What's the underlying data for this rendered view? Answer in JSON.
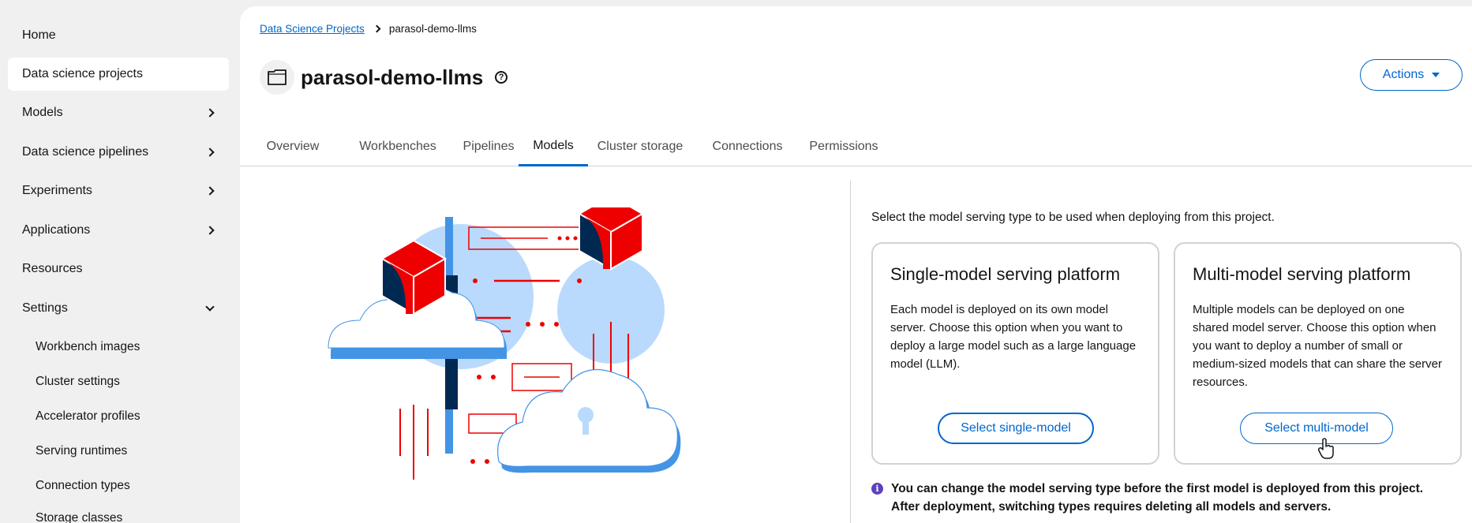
{
  "sidebar": {
    "items": [
      {
        "label": "Home"
      },
      {
        "label": "Data science projects"
      },
      {
        "label": "Models"
      },
      {
        "label": "Data science pipelines"
      },
      {
        "label": "Experiments"
      },
      {
        "label": "Applications"
      },
      {
        "label": "Resources"
      },
      {
        "label": "Settings"
      }
    ],
    "settings_sub": [
      {
        "label": "Workbench images"
      },
      {
        "label": "Cluster settings"
      },
      {
        "label": "Accelerator profiles"
      },
      {
        "label": "Serving runtimes"
      },
      {
        "label": "Connection types"
      },
      {
        "label": "Storage classes"
      }
    ]
  },
  "breadcrumb": {
    "root": "Data Science Projects",
    "current": "parasol-demo-llms"
  },
  "page": {
    "title": "parasol-demo-llms",
    "actions_label": "Actions"
  },
  "tabs": [
    {
      "label": "Overview"
    },
    {
      "label": "Workbenches"
    },
    {
      "label": "Pipelines"
    },
    {
      "label": "Models"
    },
    {
      "label": "Cluster storage"
    },
    {
      "label": "Connections"
    },
    {
      "label": "Permissions"
    }
  ],
  "serving": {
    "intro": "Select the model serving type to be used when deploying from this project.",
    "single": {
      "title": "Single-model serving platform",
      "description": "Each model is deployed on its own model server. Choose this option when you want to deploy a large model such as a large language model (LLM).",
      "button": "Select single-model"
    },
    "multi": {
      "title": "Multi-model serving platform",
      "description": "Multiple models can be deployed on one shared model server. Choose this option when you want to deploy a number of small or medium-sized models that can share the server resources.",
      "button": "Select multi-model"
    },
    "alert": "You can change the model serving type before the first model is deployed from this project. After deployment, switching types requires deleting all models and servers."
  },
  "colors": {
    "link": "#0066cc",
    "accent_red": "#ee0000",
    "info": "#5e40be"
  }
}
